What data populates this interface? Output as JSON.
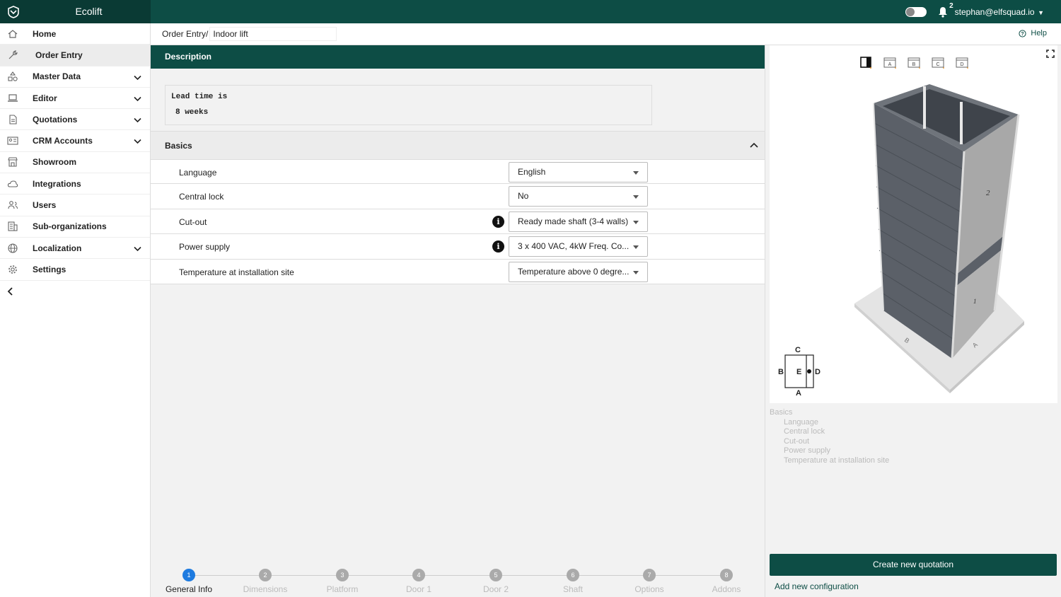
{
  "app": {
    "title": "Ecolift"
  },
  "header": {
    "user_email": "stephan@elfsquad.io",
    "notification_count": "2"
  },
  "sidebar": {
    "items": [
      {
        "label": "Home",
        "icon": "home-icon",
        "expandable": false,
        "active": false
      },
      {
        "label": "Order Entry",
        "icon": "wrench-icon",
        "expandable": false,
        "active": true
      },
      {
        "label": "Master Data",
        "icon": "shapes-icon",
        "expandable": true,
        "active": false
      },
      {
        "label": "Editor",
        "icon": "laptop-icon",
        "expandable": true,
        "active": false
      },
      {
        "label": "Quotations",
        "icon": "document-icon",
        "expandable": true,
        "active": false
      },
      {
        "label": "CRM Accounts",
        "icon": "contact-card-icon",
        "expandable": true,
        "active": false
      },
      {
        "label": "Showroom",
        "icon": "store-icon",
        "expandable": false,
        "active": false
      },
      {
        "label": "Integrations",
        "icon": "cloud-icon",
        "expandable": false,
        "active": false
      },
      {
        "label": "Users",
        "icon": "users-icon",
        "expandable": false,
        "active": false
      },
      {
        "label": "Sub-organizations",
        "icon": "building-icon",
        "expandable": false,
        "active": false
      },
      {
        "label": "Localization",
        "icon": "globe-icon",
        "expandable": true,
        "active": false
      },
      {
        "label": "Settings",
        "icon": "gear-icon",
        "expandable": false,
        "active": false
      }
    ]
  },
  "breadcrumb": {
    "prefix": "Order Entry/",
    "name_value": "Indoor lift"
  },
  "help": {
    "label": "Help"
  },
  "description": {
    "header": "Description",
    "lead_line1": "Lead time is",
    "lead_line2": "8 weeks"
  },
  "basics": {
    "title": "Basics",
    "rows": [
      {
        "label": "Language",
        "value": "English",
        "info": false
      },
      {
        "label": "Central lock",
        "value": "No",
        "info": false
      },
      {
        "label": "Cut-out",
        "value": "Ready made shaft (3-4 walls)",
        "info": true
      },
      {
        "label": "Power supply",
        "value": "3 x 400 VAC, 4kW Freq. Co...",
        "info": true
      },
      {
        "label": "Temperature at installation site",
        "value": "Temperature above 0 degre...",
        "info": false
      }
    ]
  },
  "steps": [
    {
      "num": "1",
      "label": "General Info",
      "active": true
    },
    {
      "num": "2",
      "label": "Dimensions",
      "active": false
    },
    {
      "num": "3",
      "label": "Platform",
      "active": false
    },
    {
      "num": "4",
      "label": "Door 1",
      "active": false
    },
    {
      "num": "5",
      "label": "Door 2",
      "active": false
    },
    {
      "num": "6",
      "label": "Shaft",
      "active": false
    },
    {
      "num": "7",
      "label": "Options",
      "active": false
    },
    {
      "num": "8",
      "label": "Addons",
      "active": false
    }
  ],
  "viewer": {
    "view_buttons": [
      "",
      "A",
      "B",
      "C",
      "D"
    ],
    "wall_labels": {
      "a": "A",
      "b": "B",
      "wall1": "1",
      "wall2": "2"
    },
    "minimap": {
      "top": "C",
      "left": "B",
      "center": "E",
      "right": "D",
      "bottom": "A"
    }
  },
  "outline": {
    "title": "Basics",
    "items": [
      "Language",
      "Central lock",
      "Cut-out",
      "Power supply",
      "Temperature at installation site"
    ]
  },
  "actions": {
    "create_quotation": "Create new quotation",
    "add_configuration": "Add new configuration"
  }
}
